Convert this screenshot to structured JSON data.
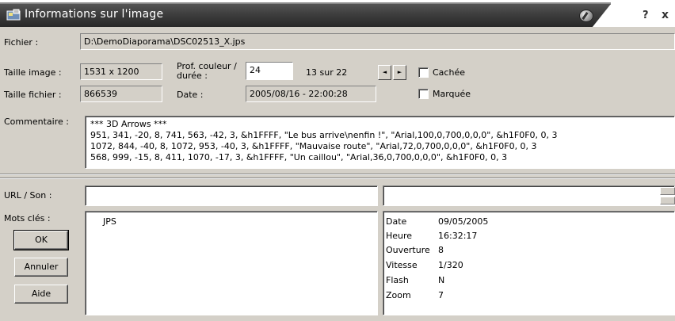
{
  "window": {
    "title": "Informations sur l'image",
    "help_glyph": "?",
    "close_glyph": "x"
  },
  "fields": {
    "fichier_label": "Fichier :",
    "fichier_value": "D:\\DemoDiaporama\\DSC02513_X.jps",
    "taille_image_label": "Taille image :",
    "taille_image_value": "1531 x 1200",
    "prof_couleur_label_1": "Prof. couleur /",
    "prof_couleur_label_2": "durée :",
    "prof_couleur_value": "24",
    "position_text": "13  sur 22",
    "cachee_label": "Cachée",
    "taille_fichier_label": "Taille fichier :",
    "taille_fichier_value": "866539",
    "date_label": "Date :",
    "date_value": "2005/08/16 - 22:00:28",
    "marquee_label": "Marquée",
    "commentaire_label": "Commentaire :",
    "commentaire_value": "*** 3D Arrows ***\n951, 341, -20, 8, 741, 563, -42, 3, &h1FFFF, \"Le bus arrive\\nenfin !\", \"Arial,100,0,700,0,0,0\", &h1F0F0, 0, 3\n1072, 844, -40, 8, 1072, 953, -40, 3, &h1FFFF, \"Mauvaise route\", \"Arial,72,0,700,0,0,0\", &h1F0F0, 0, 3\n568, 999, -15, 8, 411, 1070, -17, 3, &h1FFFF, \"Un caillou\", \"Arial,36,0,700,0,0,0\", &h1F0F0, 0, 3",
    "url_son_label": "URL / Son :",
    "url_son_value": "",
    "url_son_value2": "",
    "mots_cles_label": "Mots clés :",
    "mots_cles_value": "JPS"
  },
  "nav": {
    "prev_glyph": "◄",
    "next_glyph": "►"
  },
  "checks": {
    "cachee": false,
    "marquee": false
  },
  "buttons": {
    "ok": "OK",
    "annuler": "Annuler",
    "aide": "Aide"
  },
  "exif": [
    {
      "key": "Date",
      "value": "09/05/2005"
    },
    {
      "key": "Heure",
      "value": "16:32:17"
    },
    {
      "key": "Ouverture",
      "value": "8"
    },
    {
      "key": "Vitesse",
      "value": "1/320"
    },
    {
      "key": "Flash",
      "value": "N"
    },
    {
      "key": "Zoom",
      "value": "7"
    }
  ],
  "colors": {
    "dialog_bg": "#d4d0c8",
    "titlebar_band": "#3e3e3e",
    "title_text": "#ffffff"
  }
}
